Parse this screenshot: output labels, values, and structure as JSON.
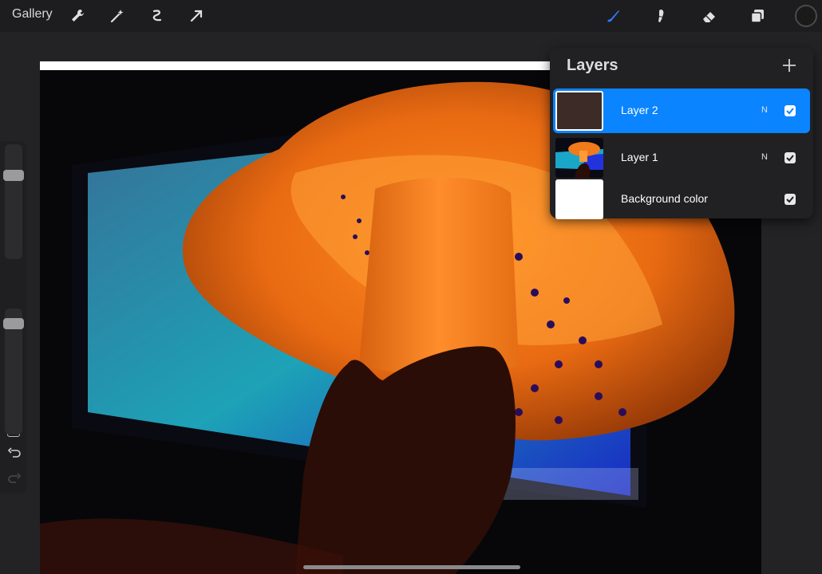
{
  "topbar": {
    "gallery_label": "Gallery",
    "left_tools": [
      "wrench-icon",
      "magic-wand-icon",
      "selection-icon",
      "transform-arrow-icon"
    ],
    "right_tools": [
      "brush-icon",
      "smudge-icon",
      "eraser-icon",
      "layers-icon",
      "color-swatch"
    ],
    "active_tool_color": "#2f7bff",
    "current_color": "#1a1a1a"
  },
  "layers_panel": {
    "title": "Layers",
    "add_icon": "plus-icon",
    "layers": [
      {
        "name": "Layer 2",
        "blend": "N",
        "visible": true,
        "selected": true
      },
      {
        "name": "Layer 1",
        "blend": "N",
        "visible": true,
        "selected": false
      },
      {
        "name": "Background color",
        "blend": "",
        "visible": true,
        "selected": false
      }
    ],
    "accent": "#0a84ff"
  },
  "sidebar": {
    "brush_size_icon": "size-slider",
    "opacity_icon": "opacity-slider",
    "modify_icon": "modify-square-icon",
    "undo_icon": "undo-icon",
    "redo_icon": "redo-icon"
  }
}
